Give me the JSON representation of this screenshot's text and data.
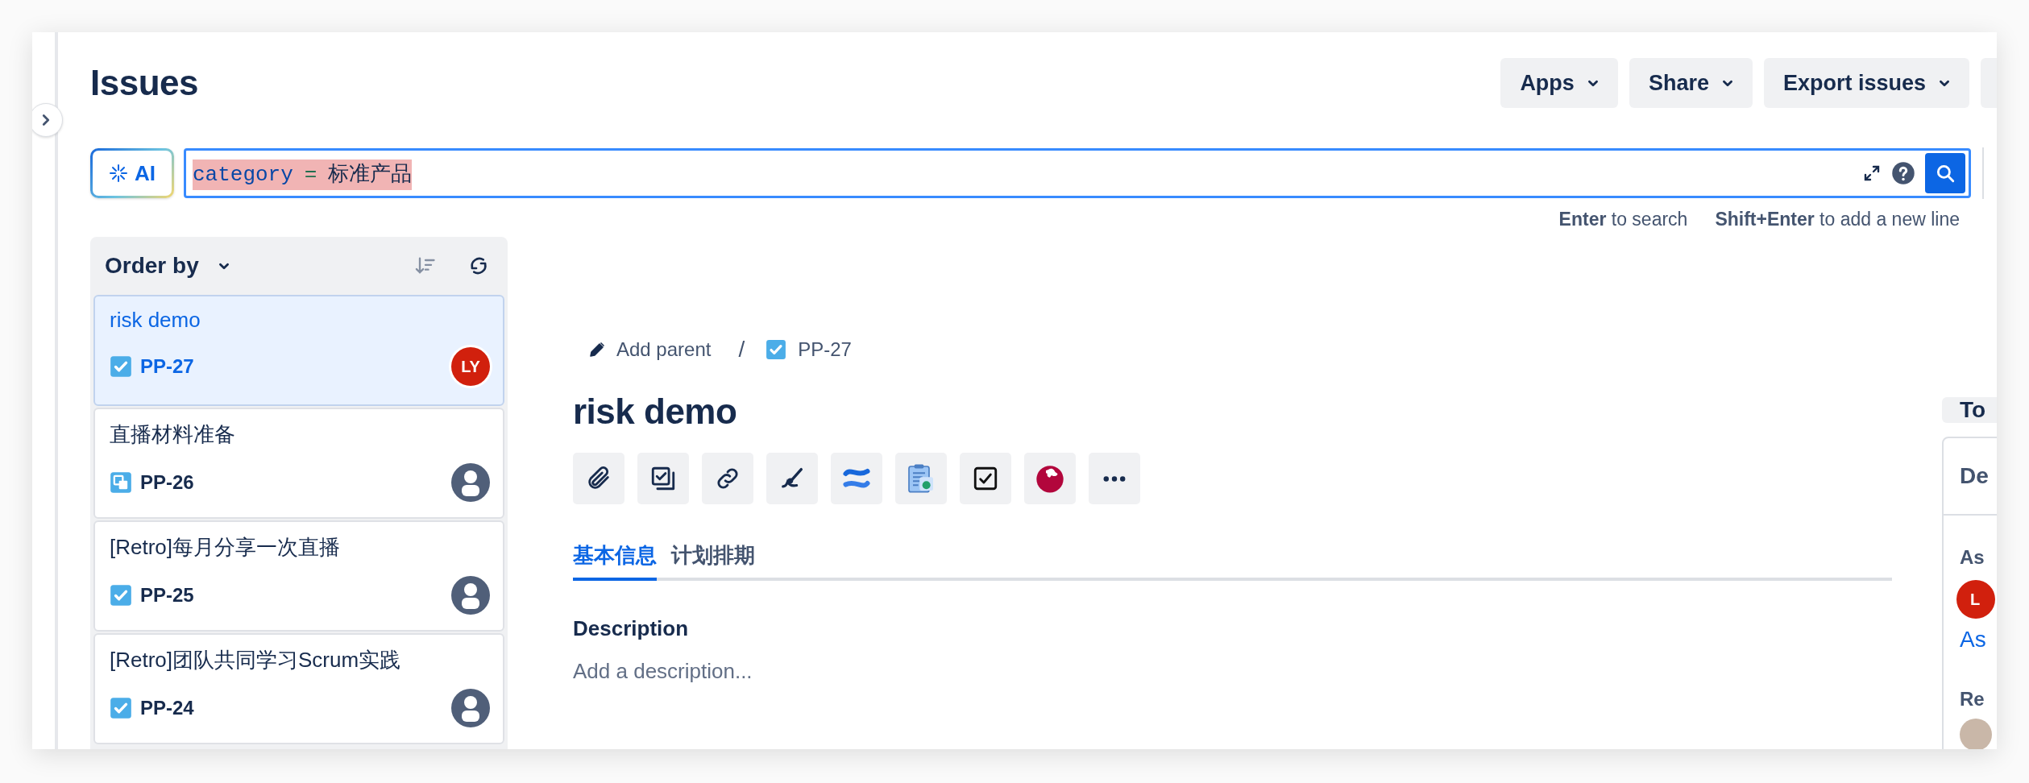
{
  "page": {
    "title": "Issues"
  },
  "header_buttons": [
    {
      "label": "Apps"
    },
    {
      "label": "Share"
    },
    {
      "label": "Export issues"
    }
  ],
  "search": {
    "ai_label": "AI",
    "query": [
      {
        "kind": "field",
        "text": "category"
      },
      {
        "kind": "operator",
        "text": "="
      },
      {
        "kind": "value",
        "text": "标准产品"
      }
    ],
    "hints": [
      "**Enter** to search",
      "**Shift+Enter** to add a new line"
    ]
  },
  "issue_list": {
    "order_label": "Order by",
    "items": [
      {
        "title": "risk demo",
        "key": "PP-27",
        "kind": "task",
        "assignee": {
          "kind": "initials",
          "initials": "LY"
        },
        "selected": true
      },
      {
        "title": "直播材料准备",
        "key": "PP-26",
        "kind": "subtask",
        "assignee": {
          "kind": "unassigned"
        },
        "selected": false
      },
      {
        "title": "[Retro]每月分享一次直播",
        "key": "PP-25",
        "kind": "task",
        "assignee": {
          "kind": "unassigned"
        },
        "selected": false
      },
      {
        "title": "[Retro]团队共同学习Scrum实践",
        "key": "PP-24",
        "kind": "task",
        "assignee": {
          "kind": "unassigned"
        },
        "selected": false
      }
    ]
  },
  "detail": {
    "add_parent": "Add parent",
    "separator": "/",
    "issue": {
      "key": "PP-27",
      "kind": "task"
    },
    "title": "risk demo",
    "tools": [
      {
        "kind": "attach"
      },
      {
        "kind": "checklist"
      },
      {
        "kind": "link"
      },
      {
        "kind": "brush"
      },
      {
        "kind": "confluence"
      },
      {
        "kind": "clipboard"
      },
      {
        "kind": "checkbox"
      },
      {
        "kind": "tomato"
      },
      {
        "kind": "more"
      }
    ],
    "tabs": [
      {
        "label": "基本信息",
        "selected": true
      },
      {
        "label": "计划排期",
        "selected": false
      }
    ],
    "description_label": "Description",
    "description_placeholder": "Add a description..."
  },
  "right_panel": {
    "button": "To",
    "section_header": "De",
    "assignee_label": "As",
    "assignee_initials": "L",
    "assign_link": "As",
    "reporter_label": "Re"
  }
}
